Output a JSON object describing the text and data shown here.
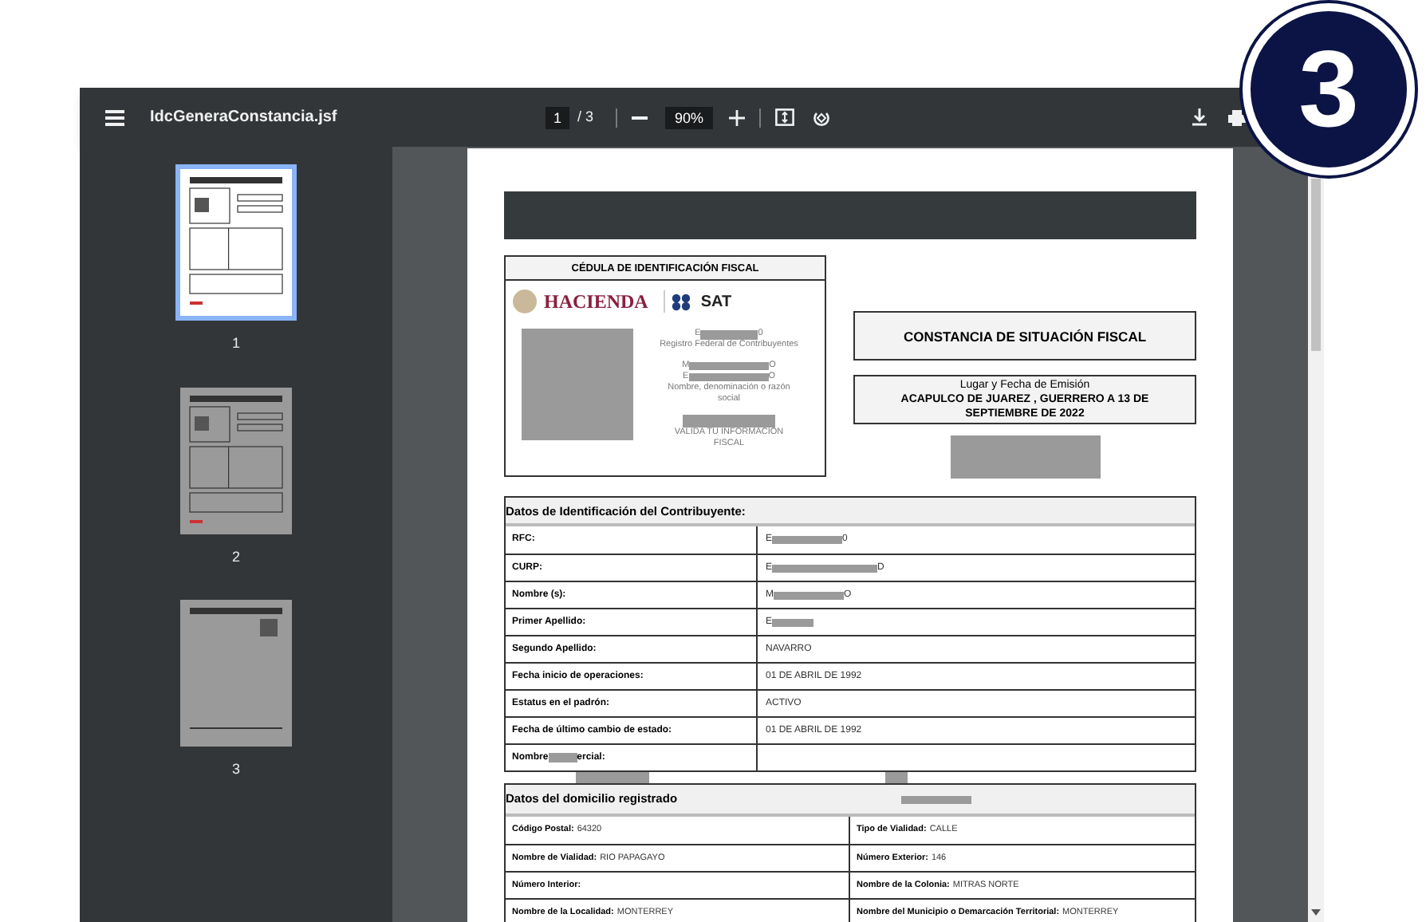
{
  "step_badge": "3",
  "toolbar": {
    "title": "IdcGeneraConstancia.jsf",
    "page": "1",
    "page_count": "/ 3",
    "zoom": "90%"
  },
  "thumbnails": [
    {
      "label": "1",
      "selected": true
    },
    {
      "label": "2",
      "selected": false
    },
    {
      "label": "3",
      "selected": false
    }
  ],
  "document": {
    "id_card": {
      "title": "CÉDULA DE IDENTIFICACIÓN FISCAL",
      "logo_left": "HACIENDA",
      "logo_right": "SAT",
      "rfc": {
        "prefix": "E",
        "suffix": "0"
      },
      "rfc_caption": "Registro Federal de Contribuyentes",
      "name_lines": [
        {
          "prefix": "M",
          "suffix": "O"
        },
        {
          "prefix": "E",
          "suffix": "O"
        }
      ],
      "name_caption": "Nombre, denominación o razón social",
      "validate": "VALIDA TU INFORMACIÓN FISCAL"
    },
    "title": "CONSTANCIA DE SITUACIÓN FISCAL",
    "emission": {
      "label": "Lugar y Fecha de Emisión",
      "value": "ACAPULCO DE JUAREZ , GUERRERO A 13 DE SEPTIEMBRE DE 2022"
    },
    "taxpayer": {
      "heading": "Datos de Identificación del Contribuyente:",
      "rows": [
        {
          "label": "RFC:",
          "value": "E",
          "suffix": "0",
          "redacted": true
        },
        {
          "label": "CURP:",
          "value": "E",
          "suffix": "D",
          "redacted": true
        },
        {
          "label": "Nombre (s):",
          "value": "M",
          "suffix": "O",
          "redacted": true
        },
        {
          "label": "Primer Apellido:",
          "value": "E",
          "redacted": true
        },
        {
          "label": "Segundo Apellido:",
          "value": "NAVARRO",
          "redacted": false
        },
        {
          "label": "Fecha inicio de operaciones:",
          "value": "01 DE ABRIL DE 1992",
          "redacted": false
        },
        {
          "label": "Estatus en el padrón:",
          "value": "ACTIVO",
          "redacted": false
        },
        {
          "label": "Fecha de último cambio de estado:",
          "value": "01 DE ABRIL DE 1992",
          "redacted": false
        },
        {
          "label": "Nombre",
          "label_suffix": "ercial:"
        }
      ]
    },
    "address": {
      "heading": "Datos del domicilio registrado",
      "rows": [
        [
          {
            "label": "Código Postal:",
            "value": "64320"
          },
          {
            "label": "Tipo de Vialidad:",
            "value": "CALLE"
          }
        ],
        [
          {
            "label": "Nombre de Vialidad:",
            "value": "RIO PAPAGAYO"
          },
          {
            "label": "Número Exterior:",
            "value": "146"
          }
        ],
        [
          {
            "label": "Número Interior:"
          },
          {
            "label": "Nombre de la Colonia:",
            "value": "MITRAS NORTE"
          }
        ],
        [
          {
            "label": "Nombre de la Localidad:",
            "value": "MONTERREY"
          },
          {
            "label": "Nombre del Municipio o Demarcación Territorial:",
            "value": "MONTERREY"
          }
        ]
      ]
    }
  }
}
